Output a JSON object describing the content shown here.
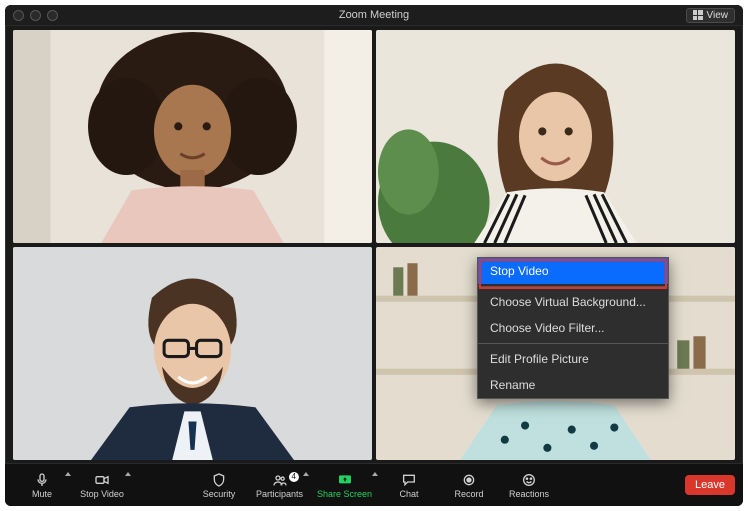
{
  "titlebar": {
    "title": "Zoom Meeting",
    "view_label": "View"
  },
  "context_menu": {
    "stop_video": "Stop Video",
    "choose_bg": "Choose Virtual Background...",
    "choose_filter": "Choose Video Filter...",
    "edit_pic": "Edit Profile Picture",
    "rename": "Rename"
  },
  "toolbar": {
    "mute": "Mute",
    "stop_video": "Stop Video",
    "security": "Security",
    "participants": "Participants",
    "participants_count": "4",
    "share_screen": "Share Screen",
    "chat": "Chat",
    "record": "Record",
    "reactions": "Reactions",
    "leave": "Leave"
  },
  "colors": {
    "accent_green": "#23d160",
    "leave_red": "#d9372b",
    "menu_highlight": "#0a6cff",
    "annotation_red": "#e03131"
  }
}
